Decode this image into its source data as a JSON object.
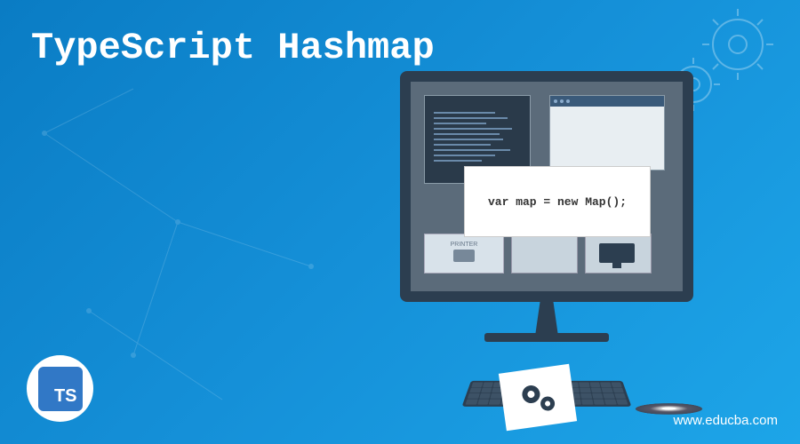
{
  "title": "TypeScript Hashmap",
  "code_snippet": "var map = new Map();",
  "badge_text": "TS",
  "printer_label": "PRINTER",
  "website": "www.educba.com"
}
